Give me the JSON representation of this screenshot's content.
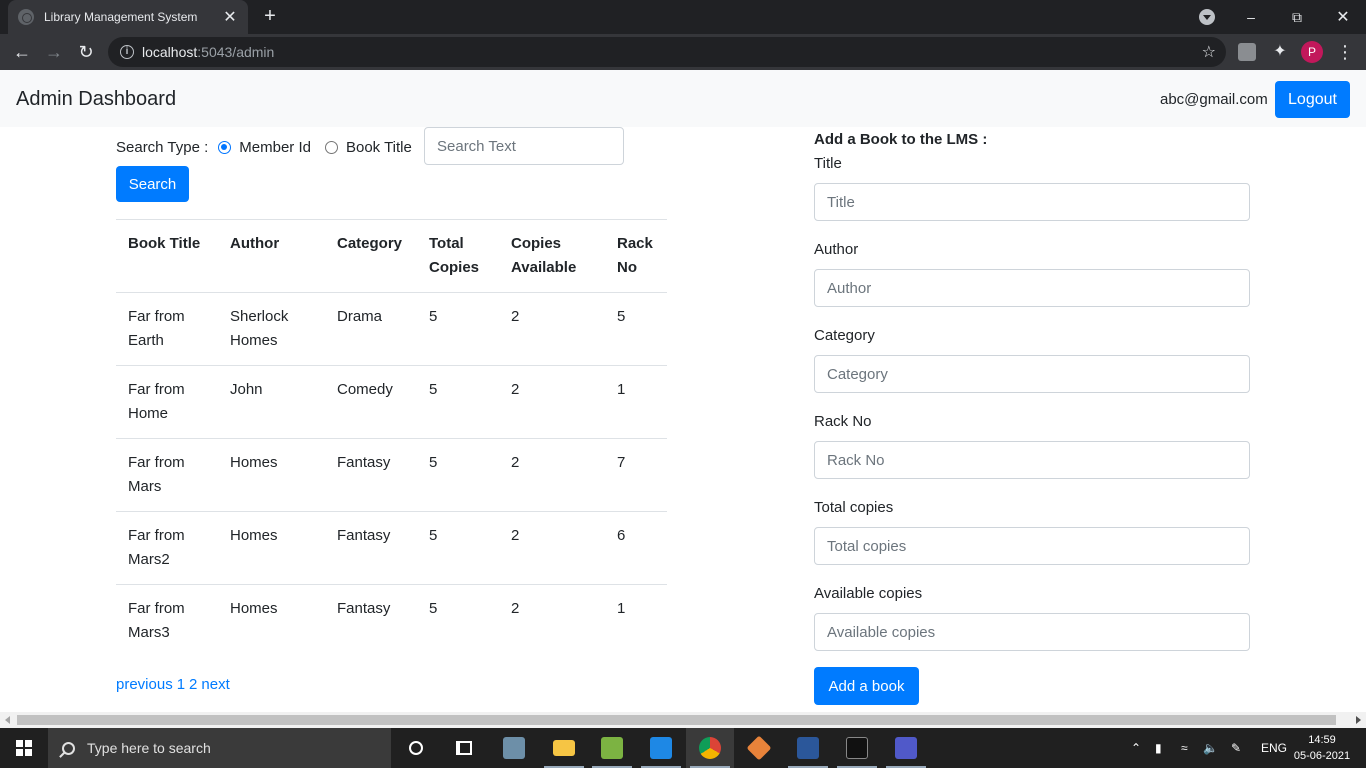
{
  "browser": {
    "tab_title": "Library Management System",
    "url_host": "localhost",
    "url_rest": ":5043/admin",
    "profile_initial": "P"
  },
  "navbar": {
    "brand": "Admin Dashboard",
    "user_email": "abc@gmail.com",
    "logout_label": "Logout"
  },
  "search": {
    "type_label": "Search Type :",
    "options": [
      {
        "label": "Member Id",
        "checked": true
      },
      {
        "label": "Book Title",
        "checked": false
      }
    ],
    "placeholder": "Search Text",
    "button_label": "Search"
  },
  "table": {
    "headers": [
      "Book Title",
      "Author",
      "Category",
      "Total Copies",
      "Copies Available",
      "Rack No"
    ],
    "rows": [
      [
        "Far from Earth",
        "Sherlock Homes",
        "Drama",
        "5",
        "2",
        "5"
      ],
      [
        "Far from Home",
        "John",
        "Comedy",
        "5",
        "2",
        "1"
      ],
      [
        "Far from Mars",
        "Homes",
        "Fantasy",
        "5",
        "2",
        "7"
      ],
      [
        "Far from Mars2",
        "Homes",
        "Fantasy",
        "5",
        "2",
        "6"
      ],
      [
        "Far from Mars3",
        "Homes",
        "Fantasy",
        "5",
        "2",
        "1"
      ]
    ]
  },
  "pager": {
    "previous": "previous",
    "pages": [
      "1",
      "2"
    ],
    "next": "next"
  },
  "add_form": {
    "heading": "Add a Book to the LMS :",
    "fields": [
      {
        "label": "Title",
        "placeholder": "Title"
      },
      {
        "label": "Author",
        "placeholder": "Author"
      },
      {
        "label": "Category",
        "placeholder": "Category"
      },
      {
        "label": "Rack No",
        "placeholder": "Rack No"
      },
      {
        "label": "Total copies",
        "placeholder": "Total copies"
      },
      {
        "label": "Available copies",
        "placeholder": "Available copies"
      }
    ],
    "submit_label": "Add a book"
  },
  "taskbar": {
    "search_placeholder": "Type here to search",
    "language": "ENG",
    "time": "14:59",
    "date": "05-06-2021"
  },
  "colors": {
    "primary": "#007bff",
    "navbar_bg": "#f8f9fa",
    "chrome_dark": "#202124"
  }
}
